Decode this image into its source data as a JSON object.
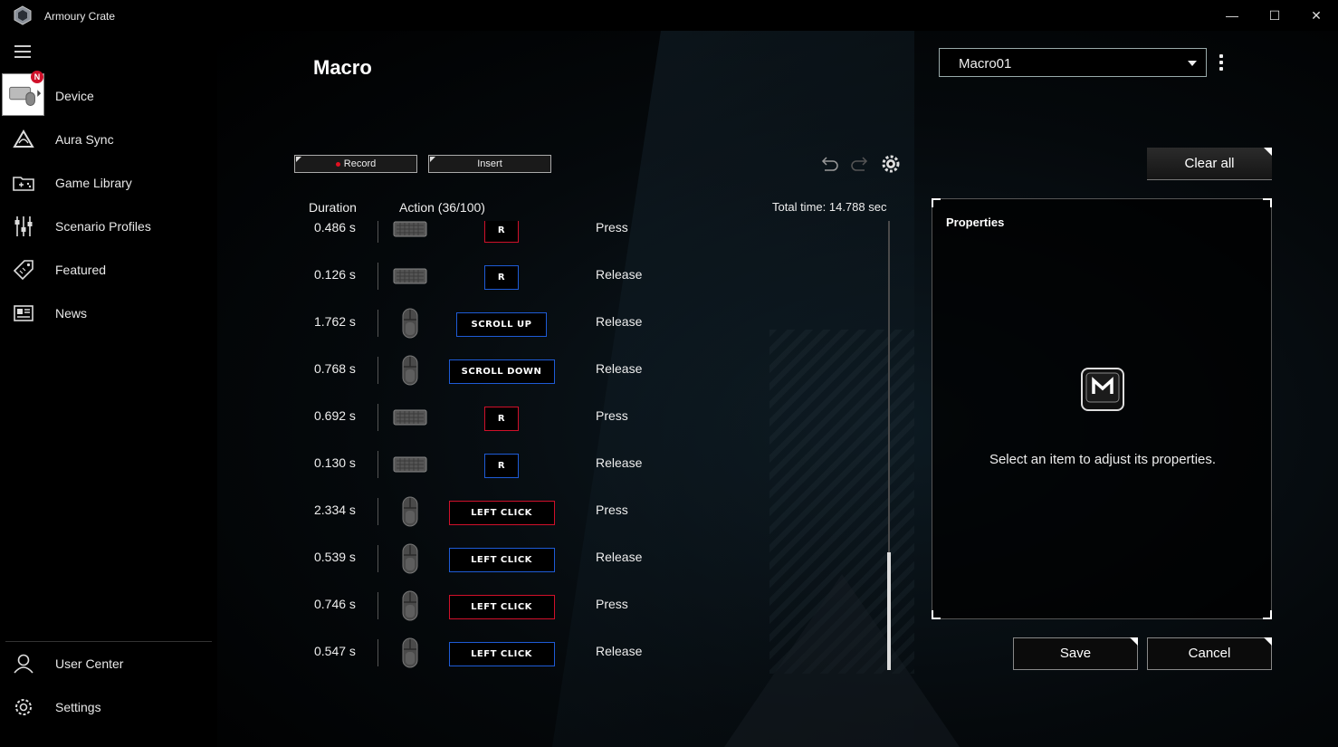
{
  "app": {
    "title": "Armoury Crate",
    "minimize": "—",
    "maximize": "☐",
    "close": "✕"
  },
  "sidebar": {
    "items": [
      {
        "label": "Device",
        "icon": "device-icon",
        "badge": "N"
      },
      {
        "label": "Aura Sync",
        "icon": "aura-sync-icon"
      },
      {
        "label": "Game Library",
        "icon": "game-library-icon"
      },
      {
        "label": "Scenario Profiles",
        "icon": "scenario-profiles-icon"
      },
      {
        "label": "Featured",
        "icon": "featured-icon"
      },
      {
        "label": "News",
        "icon": "news-icon"
      }
    ],
    "bottom": [
      {
        "label": "User Center",
        "icon": "user-center-icon"
      },
      {
        "label": "Settings",
        "icon": "settings-icon"
      }
    ]
  },
  "main": {
    "title": "Macro",
    "profile_select": "Macro01",
    "toolbar": {
      "record": "Record",
      "insert": "Insert",
      "clear_all": "Clear all"
    },
    "columns": {
      "duration": "Duration",
      "action": "Action (36/100)"
    },
    "total_time": "Total time: 14.788 sec",
    "rows": [
      {
        "duration": "0.486 s",
        "device": "keyboard",
        "key": "R",
        "action": "Press",
        "type": "press"
      },
      {
        "duration": "0.126 s",
        "device": "keyboard",
        "key": "R",
        "action": "Release",
        "type": "release"
      },
      {
        "duration": "1.762 s",
        "device": "mouse",
        "key": "SCROLL UP",
        "action": "Release",
        "type": "release"
      },
      {
        "duration": "0.768 s",
        "device": "mouse",
        "key": "SCROLL DOWN",
        "action": "Release",
        "type": "release"
      },
      {
        "duration": "0.692 s",
        "device": "keyboard",
        "key": "R",
        "action": "Press",
        "type": "press"
      },
      {
        "duration": "0.130 s",
        "device": "keyboard",
        "key": "R",
        "action": "Release",
        "type": "release"
      },
      {
        "duration": "2.334 s",
        "device": "mouse",
        "key": "LEFT CLICK",
        "action": "Press",
        "type": "press"
      },
      {
        "duration": "0.539 s",
        "device": "mouse",
        "key": "LEFT CLICK",
        "action": "Release",
        "type": "release"
      },
      {
        "duration": "0.746 s",
        "device": "mouse",
        "key": "LEFT CLICK",
        "action": "Press",
        "type": "press"
      },
      {
        "duration": "0.547 s",
        "device": "mouse",
        "key": "LEFT CLICK",
        "action": "Release",
        "type": "release"
      }
    ],
    "properties": {
      "title": "Properties",
      "hint": "Select an item to adjust its properties."
    },
    "footer": {
      "save": "Save",
      "cancel": "Cancel"
    }
  },
  "colors": {
    "press": "#d0102a",
    "release": "#1e5bd6",
    "badge": "#d0102a"
  }
}
